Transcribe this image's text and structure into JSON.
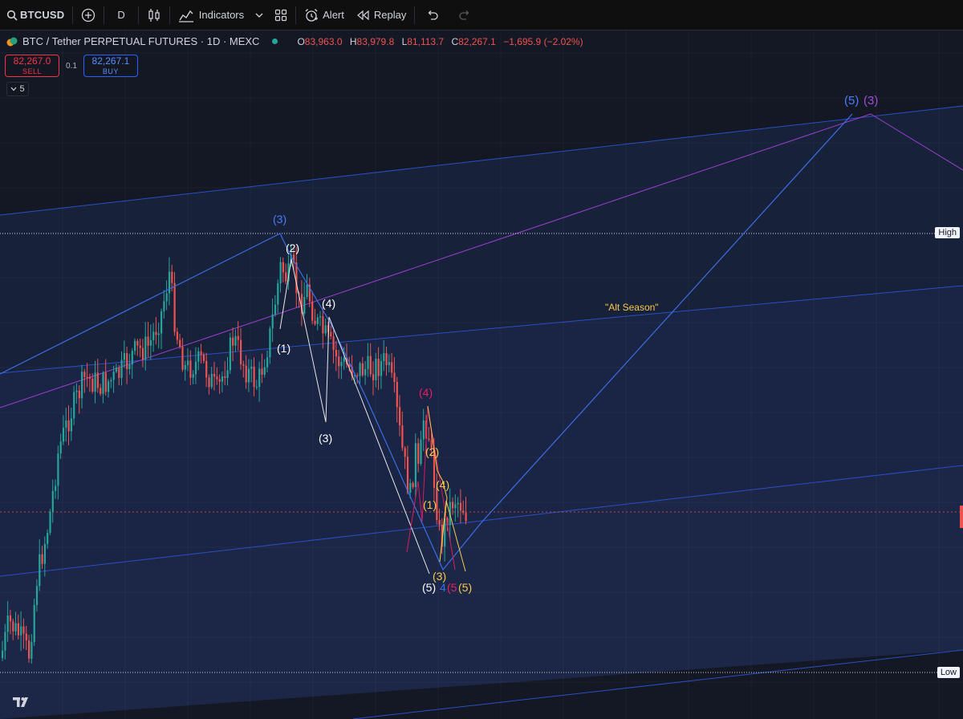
{
  "toolbar": {
    "symbol": "BTCUSD",
    "interval": "D",
    "indicators_label": "Indicators",
    "alert_label": "Alert",
    "replay_label": "Replay"
  },
  "legend": {
    "title": "BTC / Tether PERPETUAL FUTURES · 1D · MEXC",
    "o_label": "O",
    "o": "83,963.0",
    "h_label": "H",
    "h": "83,979.8",
    "l_label": "L",
    "l": "81,113.7",
    "c_label": "C",
    "c": "82,267.1",
    "change": "−1,695.9 (−2.02%)"
  },
  "trade": {
    "sell_price": "82,267.0",
    "sell_label": "SELL",
    "qty": "0.1",
    "buy_price": "82,267.1",
    "buy_label": "BUY"
  },
  "collapse_count": "5",
  "price_tags": {
    "high": "High",
    "low": "Low"
  },
  "annotations": {
    "alt_season": "\"Alt Season\"",
    "w3_top": "(3)",
    "w2": "(2)",
    "w4": "(4)",
    "w1": "(1)",
    "w3_low": "(3)",
    "pink_4": "(4)",
    "yellow_2": "(2)",
    "yellow_4": "(4)",
    "yellow_1": "(1)",
    "yellow_3": "(3)",
    "white_5": "(5)",
    "blue_4": "4",
    "pink_5": "(5",
    "yellow_5": "(5)",
    "target_5": "(5)",
    "target_3": "(3)"
  },
  "colors": {
    "up": "#26a69a",
    "down": "#ef5350",
    "blue_line": "#2962ff",
    "purple_line": "#9c27b0",
    "yellow": "#f7c948",
    "pink": "#e91e63"
  }
}
